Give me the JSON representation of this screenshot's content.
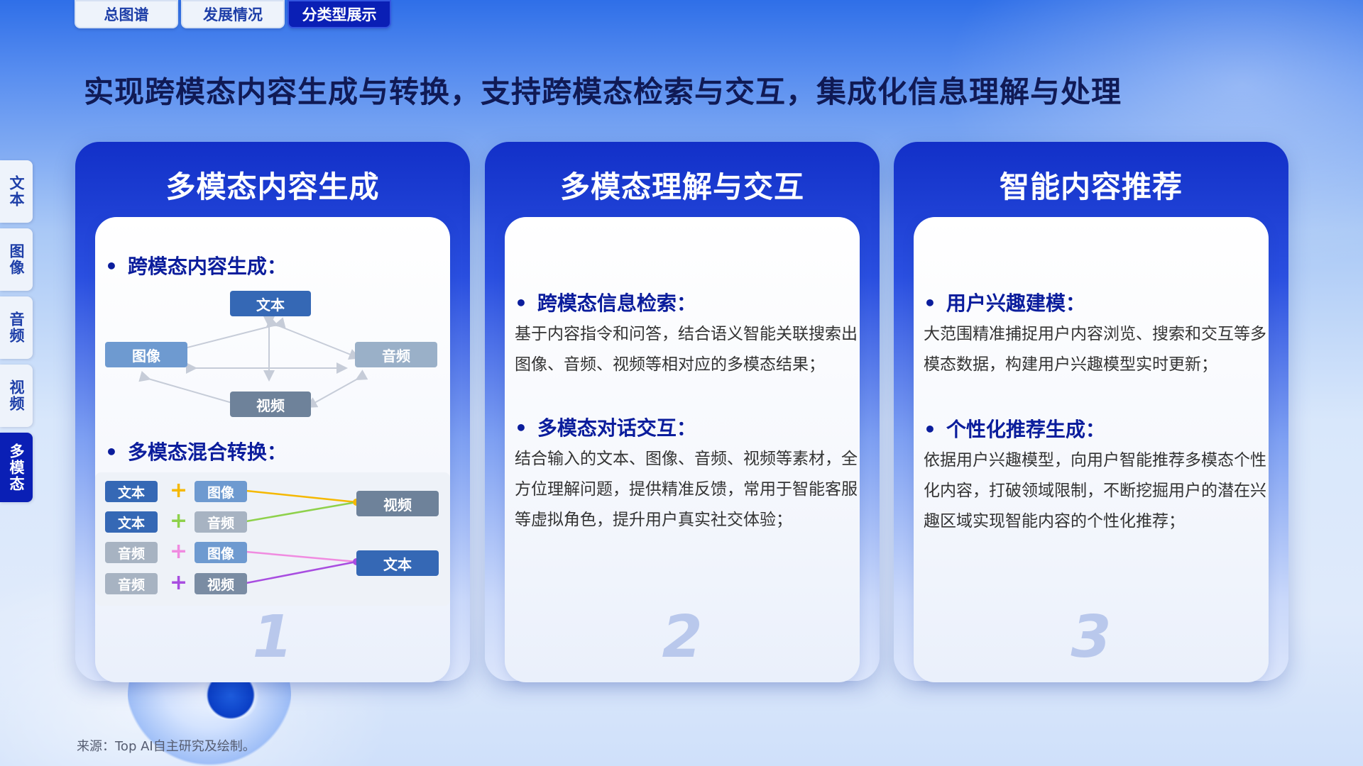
{
  "top_tabs": [
    {
      "label": "总图谱"
    },
    {
      "label": "发展情况"
    },
    {
      "label": "分类型展示"
    }
  ],
  "side_tabs": [
    {
      "label": "文本"
    },
    {
      "label": "图像"
    },
    {
      "label": "音频"
    },
    {
      "label": "视频"
    },
    {
      "label": "多模态"
    }
  ],
  "page_title": "实现跨模态内容生成与转换，支持跨模态检索与交互，集成化信息理解与处理",
  "cards": [
    {
      "title": "多模态内容生成",
      "number": "1",
      "heading1": "跨模态内容生成：",
      "heading2": "多模态混合转换：",
      "diagram": {
        "text": "文本",
        "image": "图像",
        "audio": "音频",
        "video": "视频"
      },
      "combos": {
        "row1_a": "文本",
        "row1_b": "图像",
        "row2_a": "文本",
        "row2_b": "音频",
        "row3_a": "音频",
        "row3_b": "图像",
        "row4_a": "音频",
        "row4_b": "视频",
        "out1": "视频",
        "out2": "文本",
        "plus": "+"
      }
    },
    {
      "title": "多模态理解与交互",
      "number": "2",
      "heading1": "跨模态信息检索：",
      "para1": "基于内容指令和问答，结合语义智能关联搜索出图像、音频、视频等相对应的多模态结果；",
      "heading2": "多模态对话交互：",
      "para2": "结合输入的文本、图像、音频、视频等素材，全方位理解问题，提供精准反馈，常用于智能客服等虚拟角色，提升用户真实社交体验；"
    },
    {
      "title": "智能内容推荐",
      "number": "3",
      "heading1": "用户兴趣建模：",
      "para1": "大范围精准捕捉用户内容浏览、搜索和交互等多模态数据，构建用户兴趣模型实时更新；",
      "heading2": "个性化推荐生成：",
      "para2": "依据用户兴趣模型，向用户智能推荐多模态个性化内容，打破领域限制，不断挖掘用户的潜在兴趣区域实现智能内容的个性化推荐；"
    }
  ],
  "source": "来源：Top AI自主研究及绘制。",
  "colors": {
    "accent": "#0a1fb5",
    "title": "#101a55",
    "line_yellow": "#f5b800",
    "line_green": "#8ed14b",
    "line_pink": "#f08be0",
    "line_purple": "#a84de0"
  }
}
